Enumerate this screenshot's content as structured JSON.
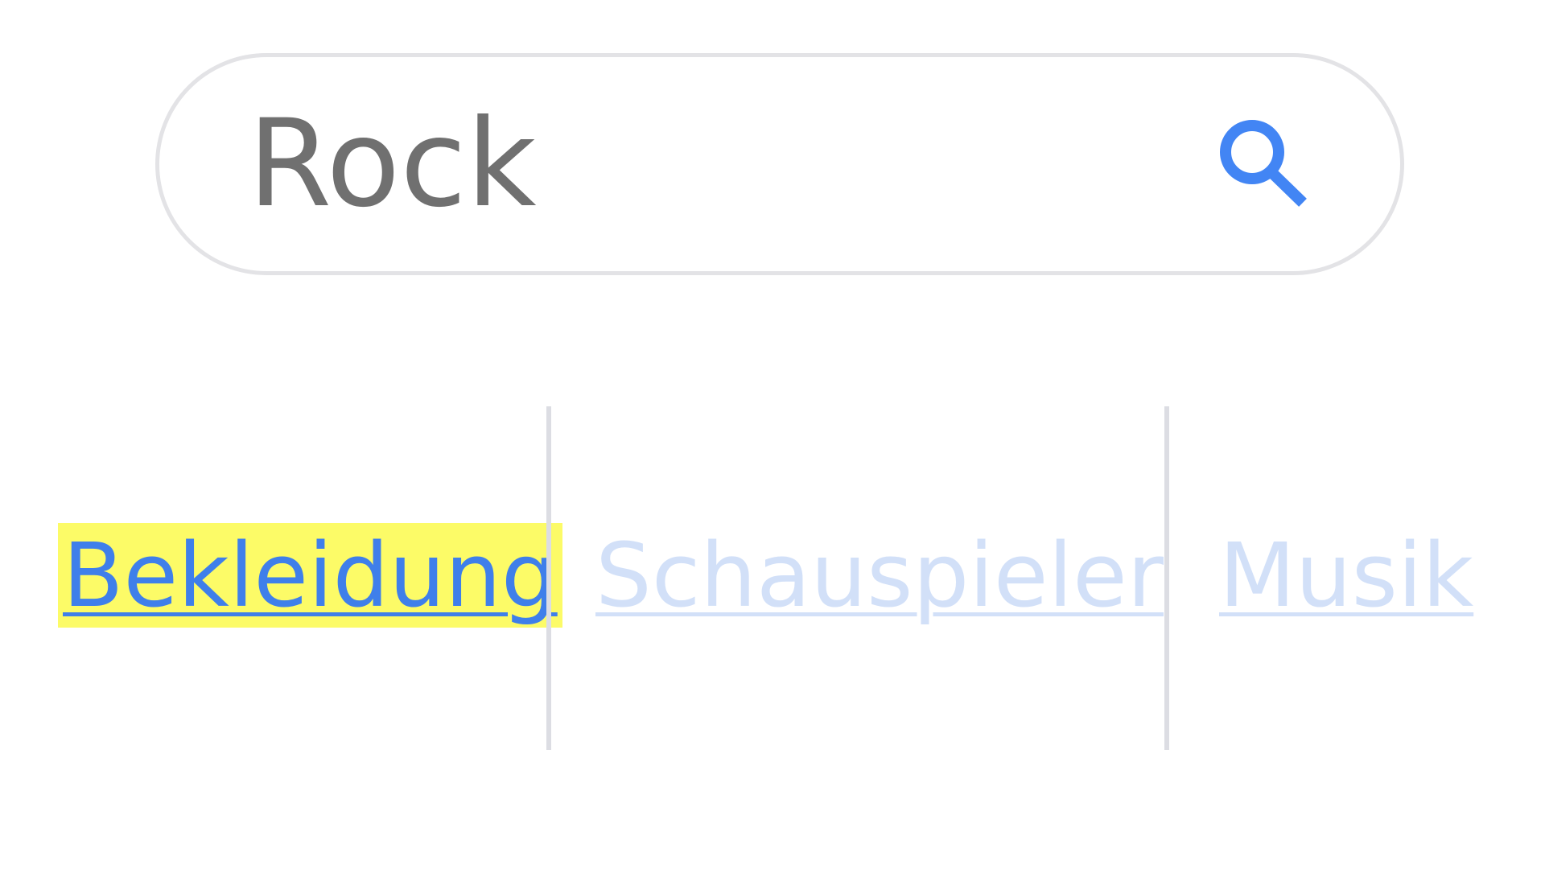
{
  "search": {
    "query": "Rock",
    "icon": "search-icon",
    "icon_color": "#4285F4"
  },
  "categories": {
    "items": [
      {
        "label": "Bekleidung",
        "state": "selected"
      },
      {
        "label": "Schauspieler",
        "state": "unselected"
      },
      {
        "label": "Musik",
        "state": "unselected"
      }
    ]
  },
  "colors": {
    "selected_text": "#3F7FEA",
    "selected_highlight": "#FCFB67",
    "unselected_text": "#D2E0F8",
    "search_text": "#707070",
    "border": "#E3E3E6"
  }
}
